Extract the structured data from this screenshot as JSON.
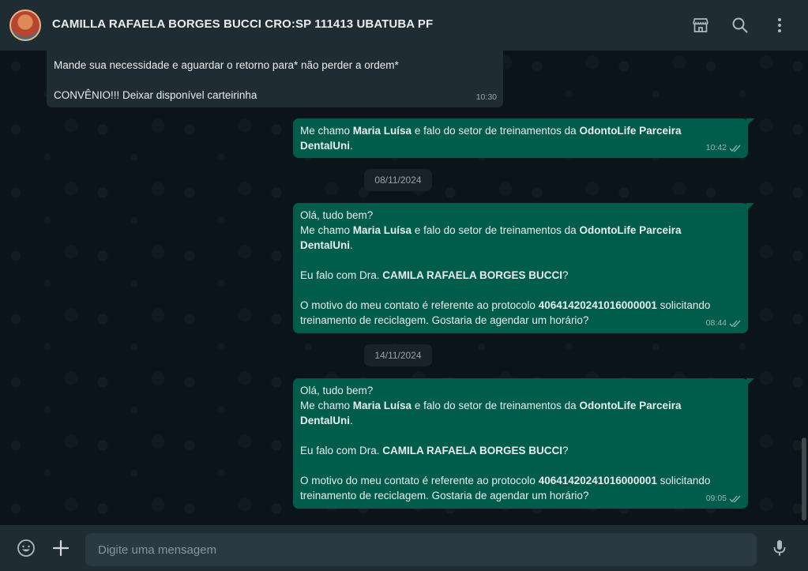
{
  "header": {
    "contact_name": "CAMILLA RAFAELA BORGES BUCCI CRO:SP 111413 UBATUBA PF",
    "icons": [
      "store-icon",
      "search-icon",
      "menu-icon"
    ]
  },
  "messages": {
    "m0": {
      "direction": "incoming",
      "line1": "Mande sua necessidade e aguardar o retorno para* não perder a ordem*",
      "line2": "CONVÊNIO!!! Deixar disponível carteirinha",
      "time": "10:30"
    },
    "m1": {
      "direction": "outgoing",
      "t1": "Me chamo ",
      "b1": "Maria Luísa",
      "t2": " e falo do setor de treinamentos da ",
      "b2": "OdontoLife Parceira",
      "b3": "DentalUni",
      "t3": ".",
      "time": "10:42",
      "status": "read"
    },
    "date1": "08/11/2024",
    "m2": {
      "direction": "outgoing",
      "greeting": "Olá, tudo bem?",
      "t1": "Me chamo ",
      "b1": "Maria Luísa",
      "t2": " e falo do setor de treinamentos da ",
      "b2": "OdontoLife Parceira",
      "b3": "DentalUni",
      "t3": ".",
      "t4": "Eu falo com Dra. ",
      "b4": "CAMILA RAFAELA BORGES BUCCI",
      "t5": "?",
      "t6": "O motivo do meu contato é referente ao protocolo ",
      "b5": "40641420241016000001",
      "t7": " solicitando",
      "t8": "treinamento de reciclagem. Gostaria de agendar um horário?",
      "time": "08:44",
      "status": "read"
    },
    "date2": "14/11/2024",
    "m3": {
      "direction": "outgoing",
      "greeting": "Olá, tudo bem?",
      "t1": "Me chamo ",
      "b1": "Maria Luísa",
      "t2": " e falo do setor de treinamentos da ",
      "b2": "OdontoLife Parceira",
      "b3": "DentalUni",
      "t3": ".",
      "t4": "Eu falo com Dra. ",
      "b4": "CAMILA RAFAELA BORGES BUCCI",
      "t5": "?",
      "t6": "O motivo do meu contato é referente ao protocolo ",
      "b5": "40641420241016000001",
      "t7": " solicitando",
      "t8": "treinamento de reciclagem. Gostaria de agendar um horário?",
      "time": "09:05",
      "status": "read"
    }
  },
  "composer": {
    "placeholder": "Digite uma mensagem",
    "value": "",
    "icons": [
      "emoji-icon",
      "plus-icon",
      "microphone-icon"
    ]
  },
  "colors": {
    "header_bg": "#202c33",
    "chat_bg": "#0b141a",
    "incoming_bubble": "#202c33",
    "outgoing_bubble": "#005c4b",
    "input_bg": "#2a3942"
  }
}
